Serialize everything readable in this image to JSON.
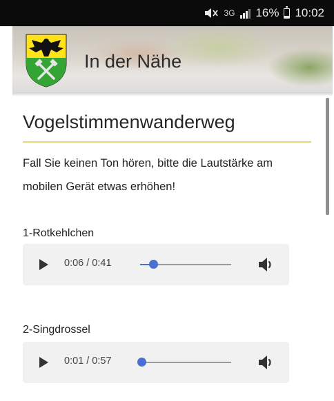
{
  "status_bar": {
    "icons": [
      "mute-icon",
      "network-3g-icon",
      "signal-icon",
      "battery-icon"
    ],
    "network_label": "3G",
    "battery_percent": "16%",
    "battery_level": 0.16,
    "time": "10:02"
  },
  "header": {
    "title": "In der Nähe",
    "crest_icon": "coat-of-arms-icon"
  },
  "content": {
    "title": "Vogelstimmenwanderweg",
    "intro": "Fall Sie keinen Ton hören, bitte die Lautstärke am mobilen Gerät etwas erhöhen!",
    "accent_color": "#e4d97a",
    "tracks": [
      {
        "label": "1-Rotkehlchen",
        "time": "0:06 / 0:41",
        "progress": 0.146
      },
      {
        "label": "2-Singdrossel",
        "time": "0:01 / 0:57",
        "progress": 0.018
      }
    ]
  },
  "colors": {
    "status_bar_bg": "#0b0b0b",
    "slider_accent": "#4a6fd3",
    "player_bg": "#f1f1f1"
  }
}
